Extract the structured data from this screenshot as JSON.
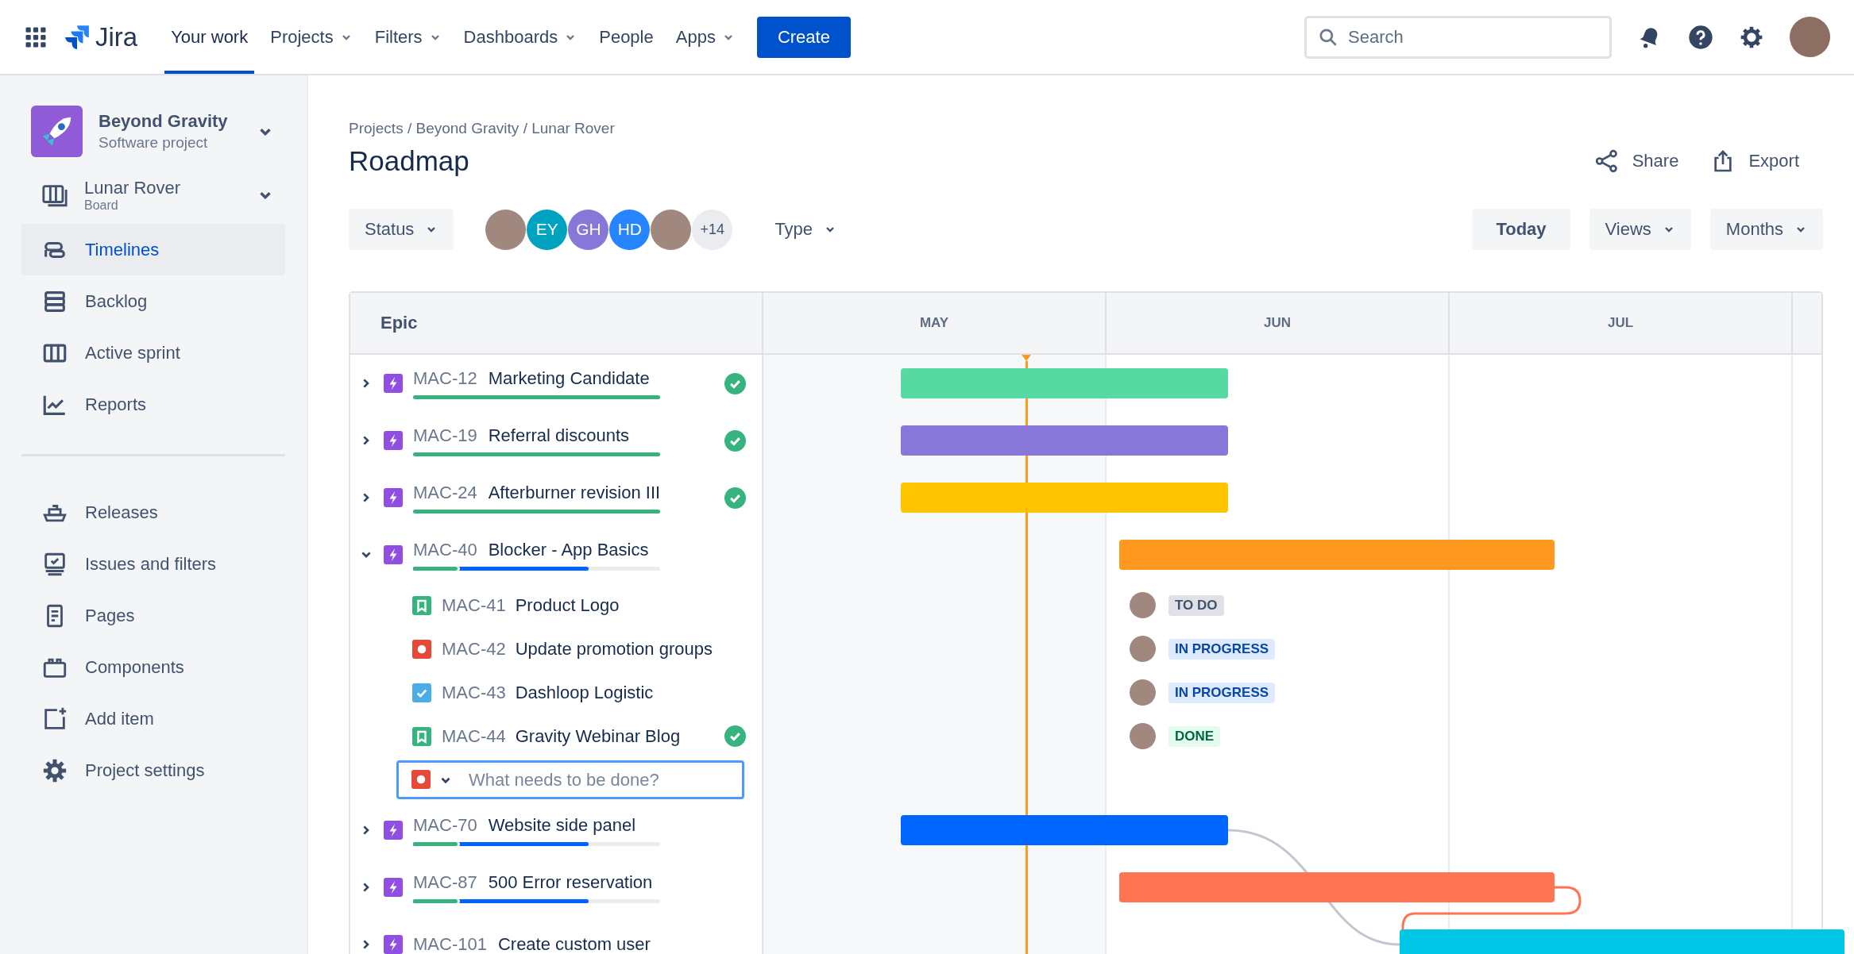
{
  "topbar": {
    "product": "Jira",
    "nav": [
      {
        "label": "Your work",
        "selected": true,
        "dropdown": false
      },
      {
        "label": "Projects",
        "selected": false,
        "dropdown": true
      },
      {
        "label": "Filters",
        "selected": false,
        "dropdown": true
      },
      {
        "label": "Dashboards",
        "selected": false,
        "dropdown": true
      },
      {
        "label": "People",
        "selected": false,
        "dropdown": false
      },
      {
        "label": "Apps",
        "selected": false,
        "dropdown": true
      }
    ],
    "create": "Create",
    "search": {
      "placeholder": "Search"
    }
  },
  "sidebar": {
    "project": {
      "name": "Beyond Gravity",
      "type": "Software project"
    },
    "board": {
      "name": "Lunar Rover",
      "type": "Board"
    },
    "items": [
      {
        "label": "Timelines",
        "selected": true
      },
      {
        "label": "Backlog",
        "selected": false
      },
      {
        "label": "Active sprint",
        "selected": false
      },
      {
        "label": "Reports",
        "selected": false
      }
    ],
    "more_items": [
      {
        "label": "Releases",
        "selected": false
      },
      {
        "label": "Issues and filters",
        "selected": false
      },
      {
        "label": "Pages",
        "selected": false
      },
      {
        "label": "Components",
        "selected": false
      },
      {
        "label": "Add item",
        "selected": false
      },
      {
        "label": "Project settings",
        "selected": false
      }
    ]
  },
  "page": {
    "breadcrumb": "Projects / Beyond Gravity / Lunar Rover",
    "title": "Roadmap",
    "actions": [
      "Share",
      "Export"
    ]
  },
  "filters": {
    "status": "Status",
    "avatars": [
      {
        "kind": "photo"
      },
      {
        "kind": "initials",
        "initials": "EY",
        "color": "#00a3bf"
      },
      {
        "kind": "initials",
        "initials": "GH",
        "color": "#8777d9"
      },
      {
        "kind": "initials",
        "initials": "HD",
        "color": "#2684ff"
      },
      {
        "kind": "photo"
      },
      {
        "kind": "more",
        "initials": "+14"
      }
    ],
    "type": "Type"
  },
  "view_controls": [
    {
      "label": "Today",
      "dropdown": false
    },
    {
      "label": "Views",
      "dropdown": true
    },
    {
      "label": "Months",
      "dropdown": true
    }
  ],
  "roadmap": {
    "epic_header": "Epic",
    "months": [
      "MAY",
      "JUN",
      "JUL"
    ],
    "rows": [
      {
        "kind": "epic",
        "key": "MAC-12",
        "title": "Marketing Candidate",
        "expanded": false,
        "done": true,
        "color": "#57d9a3",
        "progress": [
          {
            "kind": "done",
            "level": 1
          }
        ]
      },
      {
        "kind": "epic",
        "key": "MAC-19",
        "title": "Referral discounts",
        "expanded": false,
        "done": true,
        "color": "#8777d9",
        "progress": [
          {
            "kind": "done",
            "level": 1
          }
        ]
      },
      {
        "kind": "epic",
        "key": "MAC-24",
        "title": "Afterburner revision III",
        "expanded": false,
        "done": true,
        "color": "#ffc400",
        "progress": [
          {
            "kind": "done",
            "level": 1
          }
        ]
      },
      {
        "kind": "epic",
        "key": "MAC-40",
        "title": "Blocker - App Basics",
        "expanded": true,
        "done": false,
        "color": "#ff991f",
        "progress": [
          {
            "kind": "done",
            "level": 0.19
          },
          {
            "kind": "in_progress",
            "level": 0.71
          }
        ]
      },
      {
        "kind": "story",
        "key": "MAC-41",
        "title": "Product Logo",
        "done": false,
        "status": {
          "kind": "todo",
          "label": "TO DO"
        }
      },
      {
        "kind": "bug",
        "key": "MAC-42",
        "title": "Update promotion groups",
        "done": false,
        "status": {
          "kind": "in_progress",
          "label": "IN PROGRESS"
        }
      },
      {
        "kind": "task",
        "key": "MAC-43",
        "title": "Dashloop Logistic",
        "done": false,
        "status": {
          "kind": "in_progress",
          "label": "IN PROGRESS"
        }
      },
      {
        "kind": "story",
        "key": "MAC-44",
        "title": "Gravity Webinar Blog",
        "done": true,
        "status": {
          "kind": "done",
          "label": "DONE"
        }
      },
      {
        "kind": "new",
        "placeholder": "What needs to be done?"
      },
      {
        "kind": "epic",
        "key": "MAC-70",
        "title": "Website side panel",
        "expanded": false,
        "done": false,
        "color": "#0065ff",
        "progress": [
          {
            "kind": "done",
            "level": 0.19
          },
          {
            "kind": "in_progress",
            "level": 0.71
          }
        ]
      },
      {
        "kind": "epic",
        "key": "MAC-87",
        "title": "500 Error reservation",
        "expanded": false,
        "done": false,
        "color": "#ff7452",
        "progress": [
          {
            "kind": "done",
            "level": 0.19
          },
          {
            "kind": "in_progress",
            "level": 0.71
          }
        ]
      },
      {
        "kind": "epic",
        "key": "MAC-101",
        "title": "Create custom user",
        "expanded": false,
        "done": false,
        "color": "#00c7e6",
        "progress": []
      }
    ]
  }
}
